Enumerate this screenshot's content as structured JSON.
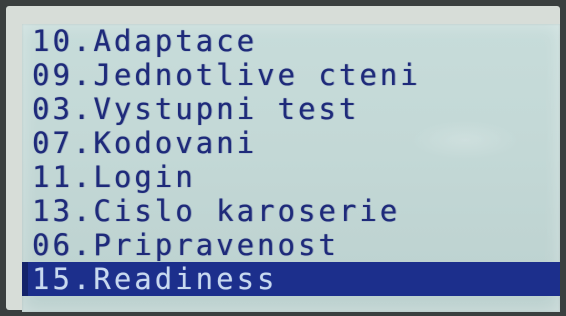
{
  "menu": {
    "items": [
      {
        "label": "10.Adaptace",
        "selected": false
      },
      {
        "label": "09.Jednotlive cteni",
        "selected": false
      },
      {
        "label": "03.Vystupni test",
        "selected": false
      },
      {
        "label": "07.Kodovani",
        "selected": false
      },
      {
        "label": "11.Login",
        "selected": false
      },
      {
        "label": "13.Cislo karoserie",
        "selected": false
      },
      {
        "label": "06.Pripravenost",
        "selected": false
      },
      {
        "label": "15.Readiness",
        "selected": true
      }
    ]
  },
  "colors": {
    "lcd_background": "#c3d8d6",
    "text": "#1e2a7a",
    "selection_background": "#1c2f8c",
    "selection_text": "#c8d9f0"
  }
}
